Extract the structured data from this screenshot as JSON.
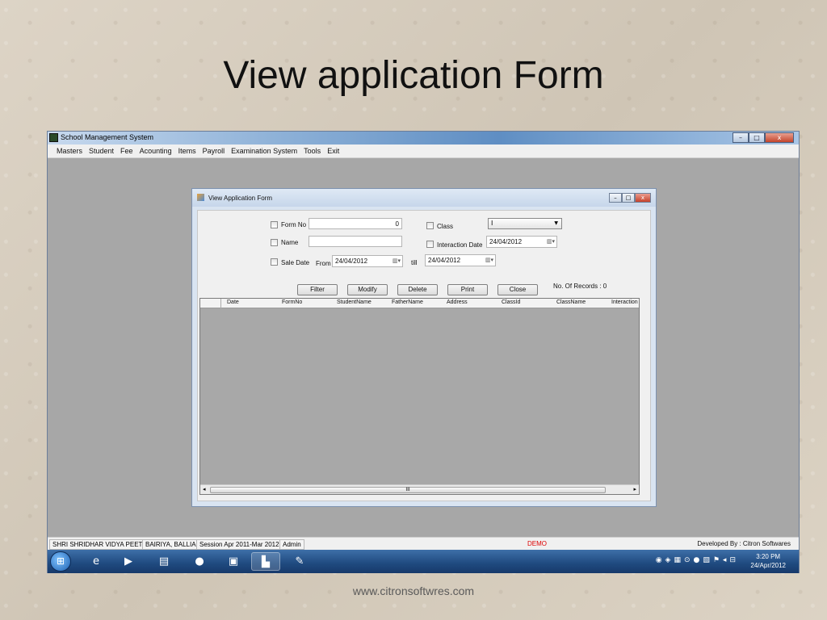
{
  "slide": {
    "title": "View application Form",
    "footer_url": "www.citronsoftwres.com"
  },
  "window": {
    "title": "School Management System",
    "controls": {
      "minimize": "–",
      "maximize": "□",
      "close": "x"
    }
  },
  "menu": [
    "Masters",
    "Student",
    "Fee",
    "Acounting",
    "Items",
    "Payroll",
    "Examination System",
    "Tools",
    "Exit"
  ],
  "form": {
    "title": "View Application Form",
    "controls": {
      "minimize": "–",
      "maximize": "□",
      "close": "x"
    },
    "form_no_label": "Form No",
    "form_no_value": "0",
    "name_label": "Name",
    "name_value": "",
    "sale_date_label": "Sale Date",
    "from_label": "From",
    "from_date": "24/04/2012",
    "till_label": "till",
    "till_date": "24/04/2012",
    "class_label": "Class",
    "class_value": "I",
    "interaction_date_label": "Interaction Date",
    "interaction_date": "24/04/2012",
    "buttons": {
      "filter": "Filter",
      "modify": "Modify",
      "delete": "Delete",
      "print": "Print",
      "close": "Close"
    },
    "records_label": "No. Of Records : 0",
    "grid_columns": [
      "Date",
      "FormNo",
      "StudentName",
      "FatherName",
      "Address",
      "ClassId",
      "ClassName",
      "Interaction"
    ],
    "scroll_thumb": "III"
  },
  "status": {
    "school": "SHRI SHRIDHAR VIDYA PEETH",
    "place": "BAIRIYA, BALLIA",
    "session": "Session Apr 2011-Mar 2012",
    "user": "Admin",
    "demo": "DEMO",
    "developer": "Developed By : Citron Softwares"
  },
  "taskbar": {
    "time": "3:20 PM",
    "date": "24/Apr/2012"
  },
  "colors": {
    "titlebar": "#5f8ec3",
    "demo_text": "#dd0000",
    "taskbar": "#1f4a7f"
  }
}
